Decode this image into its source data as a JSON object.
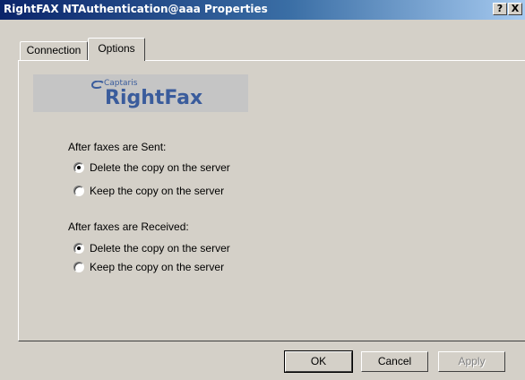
{
  "window": {
    "title": "RightFAX NTAuthentication@aaa Properties",
    "help_button": "?",
    "close_button": "X"
  },
  "tabs": [
    {
      "label": "Connection",
      "selected": false
    },
    {
      "label": "Options",
      "selected": true
    }
  ],
  "logo": {
    "small_text": "Captaris",
    "big_text": "RightFax"
  },
  "sent_section": {
    "heading": "After faxes are Sent:",
    "options": [
      {
        "label": "Delete the copy on the server",
        "checked": true
      },
      {
        "label": "Keep the copy on the server",
        "checked": false
      }
    ]
  },
  "received_section": {
    "heading": "After faxes are Received:",
    "options": [
      {
        "label": "Delete the copy on the server",
        "checked": true
      },
      {
        "label": "Keep the copy on the server",
        "checked": false
      }
    ]
  },
  "buttons": {
    "ok": "OK",
    "cancel": "Cancel",
    "apply": "Apply"
  }
}
